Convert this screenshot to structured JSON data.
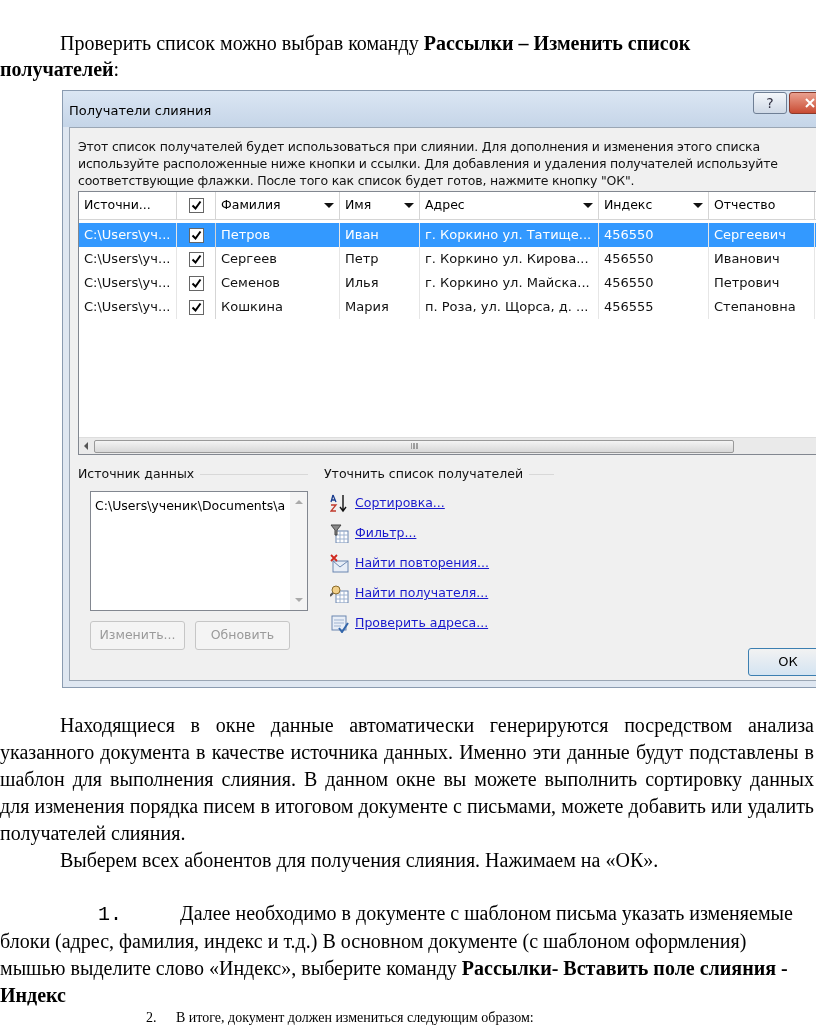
{
  "intro": "Проверить список можно выбрав команду **Рассылки – Изменить список получателей**:",
  "dialog": {
    "title": "Получатели слияния",
    "help_button": "?",
    "description": "Этот список получателей будет использоваться при слиянии. Для дополнения и изменения этого списка используйте расположенные ниже кнопки и ссылки. Для добавления и удаления получателей используйте соответствующие флажки. После того как список будет готов, нажмите кнопку \"ОК\".",
    "table": {
      "select_all": {
        "checked": true
      },
      "columns": [
        {
          "label": "Источни...",
          "dropdown": false
        },
        {
          "label": "Фамилия",
          "dropdown": true
        },
        {
          "label": "Имя",
          "dropdown": true
        },
        {
          "label": "Адрес",
          "dropdown": true
        },
        {
          "label": "Индекс",
          "dropdown": true
        },
        {
          "label": "Отчество",
          "dropdown": false
        }
      ],
      "rows": [
        {
          "selected": true,
          "checked": true,
          "cells": [
            "C:\\Users\\уч...",
            "Петров",
            "Иван",
            "г. Коркино ул. Татище...",
            "456550",
            "Сергеевич"
          ]
        },
        {
          "selected": false,
          "checked": true,
          "cells": [
            "C:\\Users\\уч...",
            "Сергеев",
            "Петр",
            "г. Коркино ул. Кирова...",
            "456550",
            "Иванович"
          ]
        },
        {
          "selected": false,
          "checked": true,
          "cells": [
            "C:\\Users\\уч...",
            "Семенов",
            "Илья",
            "г. Коркино ул. Майска...",
            "456550",
            "Петрович"
          ]
        },
        {
          "selected": false,
          "checked": true,
          "cells": [
            "C:\\Users\\уч...",
            "Кошкина",
            "Мария",
            "п. Роза, ул. Щорса, д. ...",
            "456555",
            "Степановна"
          ]
        }
      ]
    },
    "source": {
      "label": "Источник данных",
      "items": [
        "C:\\Users\\ученик\\Documents\\a"
      ],
      "buttons": [
        {
          "label": "Изменить...",
          "disabled": true
        },
        {
          "label": "Обновить",
          "disabled": true
        }
      ]
    },
    "refine": {
      "label": "Уточнить список получателей",
      "links": [
        {
          "kind": "sort",
          "label": "Сортировка..."
        },
        {
          "kind": "filter",
          "label": "Фильтр..."
        },
        {
          "kind": "duplicates",
          "label": "Найти повторения..."
        },
        {
          "kind": "find",
          "label": "Найти получателя..."
        },
        {
          "kind": "validate",
          "label": "Проверить адреса..."
        }
      ]
    },
    "ok_button": "ОК"
  },
  "paragraphs": [
    {
      "kind": "body",
      "text": "Находящиеся в окне данные автоматически генерируются посредством анализа указанного документа в качестве источника данных. Именно эти данные будут подставлены в шаблон для выполнения слияния. В данном окне вы можете выполнить сортировку данных для изменения порядка писем в итоговом документе с письмами, можете добавить или удалить получателей слияния."
    },
    {
      "kind": "body",
      "text": "Выберем всех абонентов для получения слияния. Нажимаем на «ОК»."
    },
    {
      "kind": "numbered",
      "number": "1.",
      "text": "Далее необходимо в документе с шаблоном письма указать изменяемые блоки (адрес, фамилия, индекс и т.д.) В основном документе (с шаблоном оформления) мышью выделите слово «Индекс», выберите команду **Рассылки- Вставить поле слияния - Индекс**"
    },
    {
      "kind": "small_numbered",
      "number": "2.",
      "text": "В итоге, документ должен измениться следующим образом:"
    }
  ]
}
